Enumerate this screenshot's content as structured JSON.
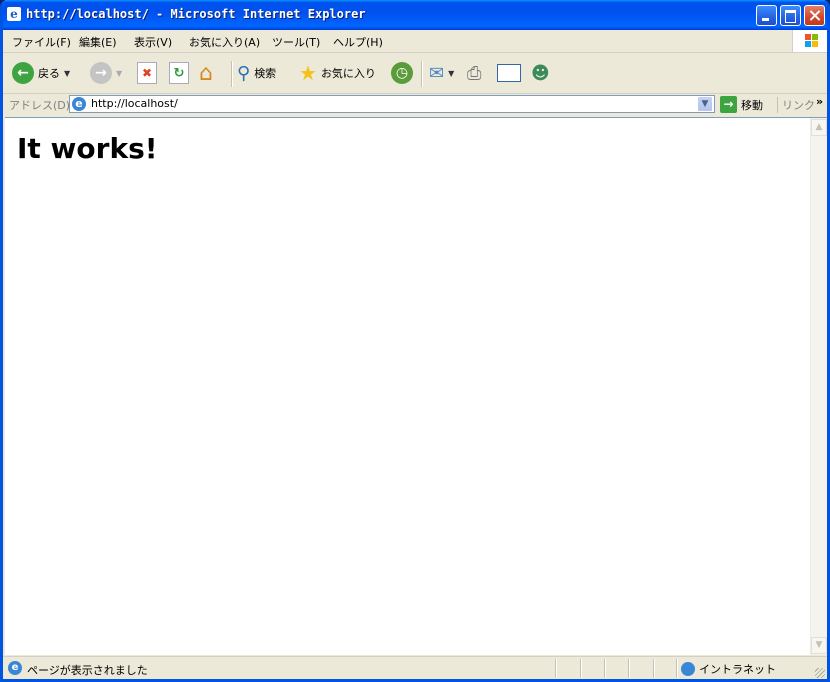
{
  "window": {
    "title": "http://localhost/ - Microsoft Internet Explorer"
  },
  "menu": {
    "items": [
      "ファイル(F)",
      "編集(E)",
      "表示(V)",
      "お気に入り(A)",
      "ツール(T)",
      "ヘルプ(H)"
    ]
  },
  "toolbar": {
    "back_label": "戻る",
    "search_label": "検索",
    "favorites_label": "お気に入り"
  },
  "address": {
    "label": "アドレス(D)",
    "value": "http://localhost/",
    "go_label": "移動",
    "links_label": "リンク"
  },
  "page": {
    "heading": "It works!"
  },
  "status": {
    "text": "ページが表示されました",
    "zone": "イントラネット"
  },
  "colors": {
    "title_bar": "#0053ee",
    "chrome": "#ece9d8",
    "back_green": "#3ea341"
  }
}
